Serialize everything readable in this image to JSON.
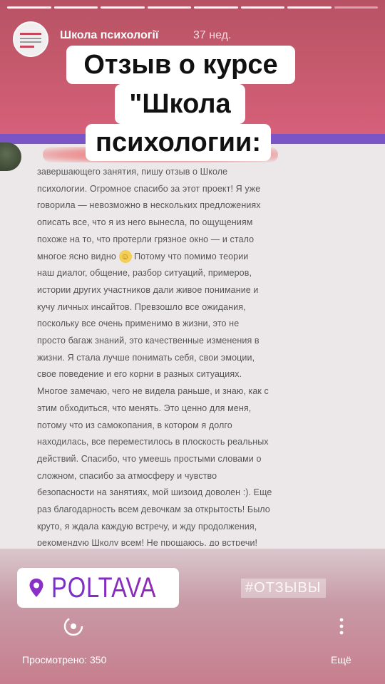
{
  "progress": {
    "total": 8,
    "completed": 7
  },
  "header": {
    "account_name": "Школа психології",
    "time_ago": "37 нед."
  },
  "title": {
    "line1": "Отзыв о курсе",
    "line2": "\"Школа",
    "line3": "психологии:"
  },
  "review": {
    "lines": [
      "завершающего занятия, пишу отзыв о Школе",
      "психологии. Огромное спасибо за этот проект! Я уже",
      "говорила — невозможно в нескольких предложениях",
      "описать все, что я из него вынесла, по ощущениям",
      "похоже на то, что протерли грязное окно — и стало",
      "многое ясно видно",
      "наш диалог, общение, разбор ситуаций, примеров,",
      "истории других участников дали живое понимание и",
      "кучу личных инсайтов. Превзошло все ожидания,",
      "поскольку все очень применимо в жизни, это не",
      "просто багаж знаний, это качественные изменения в",
      "жизни. Я стала лучше понимать себя, свои эмоции,",
      "свое поведение и его корни в разных ситуациях.",
      "Многое замечаю, чего не видела раньше, и знаю, как с",
      "этим обходиться, что менять. Это ценно для меня,",
      "потому что из самокопания, в котором я долго",
      "находилась, все переместилось в плоскость реальных",
      "действий. Спасибо, что умеешь простыми словами о",
      "сложном, спасибо за атмосферу и чувство",
      "безопасности на занятиях, мой шизоид доволен :). Еще",
      "раз благодарность всем девочкам за открытость! Было",
      "круто, я ждала каждую встречу, и жду продолжения,",
      "рекомендую Школу всем! Не прощаюсь, до встречи!"
    ],
    "line6_tail": "Потому что помимо теории"
  },
  "location": {
    "name": "POLTAVA"
  },
  "hashtag": "#ОТЗЫВЫ",
  "footer": {
    "views": "Просмотрено: 350",
    "more": "Ещё"
  },
  "colors": {
    "accent": "#7b55c6",
    "location_text": "#7b2fd0",
    "top_bg": "#c65a6d"
  }
}
